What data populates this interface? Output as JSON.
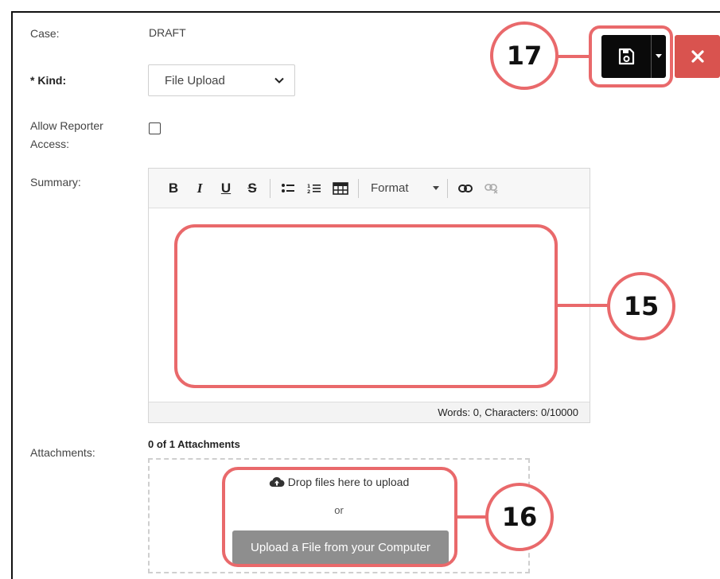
{
  "form": {
    "case_label": "Case:",
    "case_value": "DRAFT",
    "kind_label": "* Kind:",
    "kind_value": "File Upload",
    "reporter_label_line1": "Allow Reporter",
    "reporter_label_line2": "Access:",
    "reporter_checked": false,
    "summary_label": "Summary:",
    "attachments_label": "Attachments:"
  },
  "editor": {
    "toolbar": {
      "bold": "B",
      "italic": "I",
      "underline": "U",
      "strike": "S",
      "format_label": "Format"
    },
    "status": "Words: 0, Characters: 0/10000"
  },
  "attachments": {
    "count_text": "0 of 1 Attachments",
    "drop_text": "Drop files here to upload",
    "or_text": "or",
    "upload_button": "Upload a File from your Computer"
  },
  "callouts": {
    "editor": "15",
    "upload": "16",
    "save": "17"
  },
  "colors": {
    "callout": "#e9696b",
    "close_button": "#d9534f",
    "save_button": "#0a0a0a",
    "upload_button": "#8e8e8e"
  },
  "icons": {
    "save": "floppy-disk-icon",
    "save_menu": "caret-down-icon",
    "close": "x-icon",
    "upload": "cloud-upload-icon"
  }
}
